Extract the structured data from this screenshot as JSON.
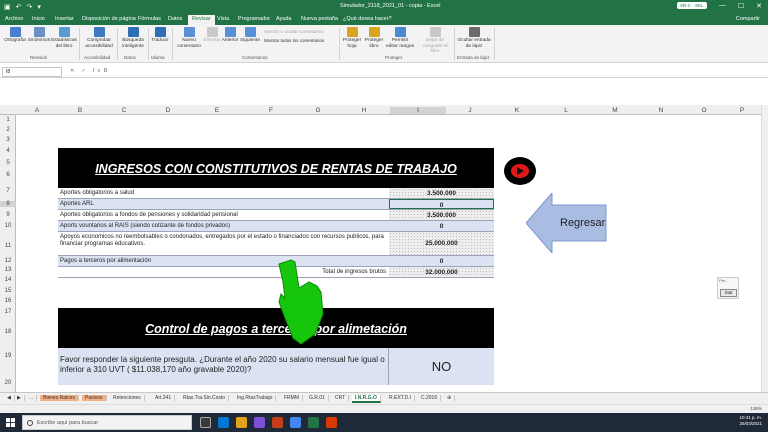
{
  "window": {
    "title": "Simulador_2118_2021_01 - copia - Excel",
    "account_badge": "SR-C - SKL",
    "min_btn": "—",
    "max_btn": "☐",
    "close_btn": "✕"
  },
  "menu_tabs": [
    "Archivo",
    "Inicio",
    "Insertar",
    "Disposición de página",
    "Fórmulas",
    "Datos",
    "Revisar",
    "Vista",
    "Programador",
    "Ayuda",
    "Nueva pestaña",
    "¿Qué desea hacer?"
  ],
  "active_tab": "Revisar",
  "share_label": "Compartir",
  "ribbon": {
    "revision": {
      "group": "Revisión",
      "buttons": [
        "Ortografía",
        "Sinónimos",
        "Estadísticas del libro"
      ]
    },
    "accesibilidad": {
      "group": "Accesibilidad",
      "buttons": [
        "Comprobar accesibilidad"
      ]
    },
    "datos": {
      "group": "Datos",
      "buttons": [
        "Búsqueda inteligente"
      ]
    },
    "idioma": {
      "group": "Idioma",
      "buttons": [
        "Traducir"
      ]
    },
    "comentarios": {
      "group": "Comentarios",
      "buttons": [
        "Nuevo comentario",
        "Eliminar",
        "Anterior",
        "Siguiente"
      ],
      "small": [
        "Mostrar u ocultar comentarios",
        "Mostrar todos los comentarios"
      ]
    },
    "proteger": {
      "group": "Proteger",
      "buttons": [
        "Proteger hoja",
        "Proteger libro",
        "Permitir editar rangos",
        "Dejar de compartir el libro"
      ]
    },
    "entrada_lapiz": {
      "group": "Entrada de lápiz",
      "buttons": [
        "Ocultar entrada de lápiz"
      ]
    }
  },
  "formula_bar": {
    "name_box": "I8",
    "fx": "✕ ✓ fx",
    "value": "0"
  },
  "columns": [
    "A",
    "B",
    "C",
    "D",
    "E",
    "F",
    "G",
    "H",
    "I",
    "J",
    "K",
    "L",
    "M",
    "N",
    "O",
    "P"
  ],
  "rows": [
    "1",
    "2",
    "3",
    "4",
    "5",
    "6",
    "7",
    "8",
    "9",
    "10",
    "11",
    "12",
    "13",
    "14",
    "15",
    "16",
    "17",
    "18",
    "19",
    "20"
  ],
  "section1": {
    "title": "INGRESOS CON CONSTITUTIVOS DE RENTAS DE TRABAJO",
    "items": [
      {
        "label": "Aportes obligatorios a salud",
        "value": "3.500.000"
      },
      {
        "label": "Aportes ARL",
        "value": "0"
      },
      {
        "label": "Aportes obligatorios  a fondos de pensiones y solidaridad pensional",
        "value": "3.500.000"
      },
      {
        "label": "Aports vountarios al RAIS (siendo cotizante de fondos privados)",
        "value": "0"
      },
      {
        "label": "Apoyos economicos no reembolsables o condonados, entregados por el estado o financiados con recursos publicos, para financiar programas educativos.",
        "value": "25.000.000"
      },
      {
        "label": "Pagos a terceros por alimentación",
        "value": "0"
      }
    ],
    "total_label": "Total de ingresos brutos",
    "total_value": "32.000.000"
  },
  "section2": {
    "title": "Control de pagos a terceros por alimetación",
    "question": "Favor responder la siguiente presguta. ¿Durante el año 2020 su  salario mensual fue igual o inferior a 310 UVT ( $11.038,170 año gravable 2020)?",
    "answer": "NO"
  },
  "regresar_label": "Regresar",
  "stat_widget": {
    "top": "Per...",
    "button": "Stat"
  },
  "sheet_tabs": [
    "...",
    "Bienes.Raices",
    "Pasivos",
    "Retenciones",
    "Art.241",
    "Rtas.Tra.Sin.Costo",
    "Ing.RtasTrabajo",
    "FRMM",
    "G.R.01",
    "CRT",
    "I.N.R.G.O",
    "R.EXT.D.I",
    "C.2016"
  ],
  "active_sheet": "I.N.R.G.O",
  "zoom": "136%",
  "taskbar": {
    "search_placeholder": "Escribe aquí para buscar",
    "time": "10:41 p. m.",
    "date": "25/03/2021"
  },
  "colors": {
    "excel_green": "#217346",
    "row_shade": "#dbe3f3",
    "header_black": "#000000",
    "arrow_blue": "#a9bce2",
    "hand_green": "#16c60c"
  }
}
